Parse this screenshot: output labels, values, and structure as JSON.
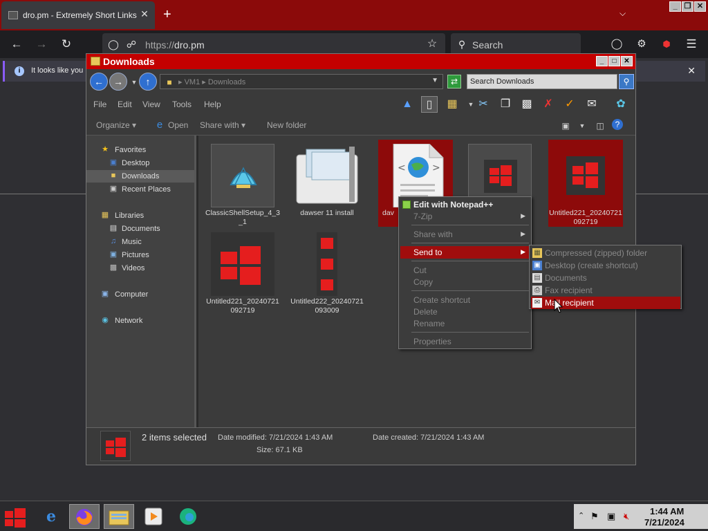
{
  "browser": {
    "tab_title": "dro.pm - Extremely Short Links",
    "tab_close": "✕",
    "new_tab": "+",
    "url_protocol": "https://",
    "url_host": "dro.pm",
    "search_placeholder": "Search",
    "notification_text": "It looks like you h",
    "notification_close": "✕",
    "window_buttons": [
      "_",
      "❐",
      "✕"
    ]
  },
  "explorer": {
    "title": "Downloads",
    "window_buttons": [
      "_",
      "□",
      "✕"
    ],
    "breadcrumb": "▸ VM1 ▸ Downloads",
    "search_placeholder": "Search Downloads",
    "menu": [
      "File",
      "Edit",
      "View",
      "Tools",
      "Help"
    ],
    "commands": {
      "organize": "Organize ▾",
      "open": "Open",
      "share_with": "Share with ▾",
      "new_folder": "New folder"
    },
    "nav": {
      "favorites": "Favorites",
      "desktop": "Desktop",
      "downloads": "Downloads",
      "recent_places": "Recent Places",
      "libraries": "Libraries",
      "documents": "Documents",
      "music": "Music",
      "pictures": "Pictures",
      "videos": "Videos",
      "computer": "Computer",
      "network": "Network"
    },
    "files": [
      {
        "name": "ClassicShellSetup_4_3_1",
        "selected": false
      },
      {
        "name": "dawser 11 install",
        "selected": false
      },
      {
        "name": "dav",
        "selected": true
      },
      {
        "name": "",
        "selected": false
      },
      {
        "name": "Untitled221_20240721092719",
        "selected": true
      },
      {
        "name": "Untitled221_20240721092719",
        "selected": false
      },
      {
        "name": "Untitled222_20240721093009",
        "selected": false
      }
    ],
    "details": {
      "count": "2 items selected",
      "date_modified": "Date modified: 7/21/2024 1:43 AM",
      "date_created": "Date created: 7/21/2024 1:43 AM",
      "size": "Size: 67.1 KB"
    }
  },
  "context_menu": {
    "edit_notepad": "Edit with Notepad++",
    "seven_zip": "7-Zip",
    "share_with": "Share with",
    "send_to": "Send to",
    "cut": "Cut",
    "copy": "Copy",
    "create_shortcut": "Create shortcut",
    "delete": "Delete",
    "rename": "Rename",
    "properties": "Properties"
  },
  "send_to_menu": {
    "compressed": "Compressed (zipped) folder",
    "desktop": "Desktop (create shortcut)",
    "documents": "Documents",
    "fax": "Fax recipient",
    "mail": "Mail recipient"
  },
  "taskbar": {
    "time": "1:44 AM",
    "date": "7/21/2024"
  },
  "colors": {
    "accent_red": "#c40000",
    "selection_red": "#8d0a0a",
    "menu_highlight": "#a00d0d"
  }
}
